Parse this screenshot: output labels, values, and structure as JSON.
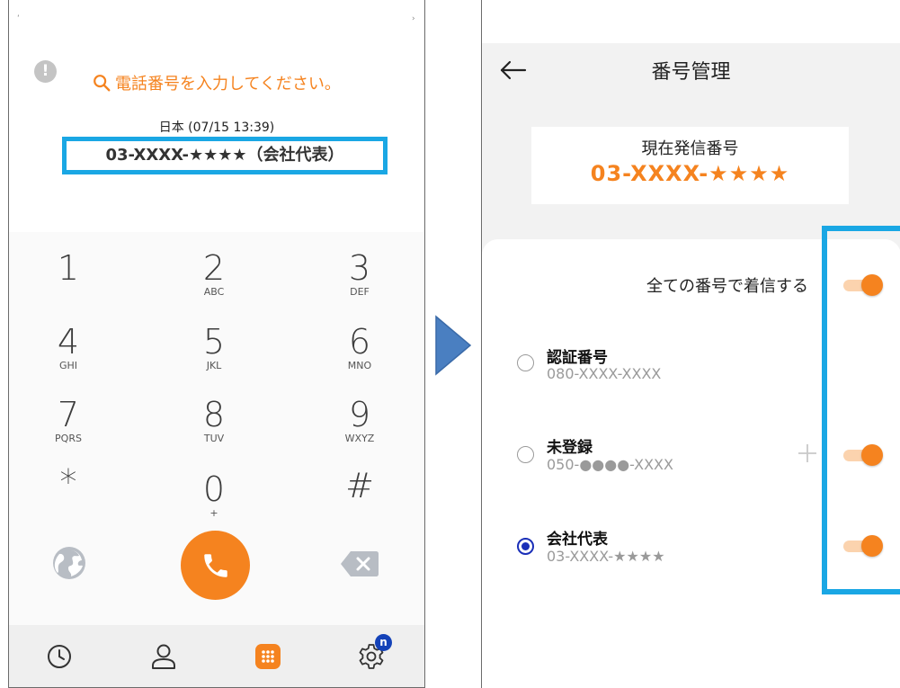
{
  "dialer": {
    "search_hint": "電話番号を入力してください。",
    "caller_country_time": "日本 (07/15 13:39)",
    "caller_number": "03-XXXX-★★★★（会社代表）",
    "keys": [
      {
        "digit": "1",
        "letters": ""
      },
      {
        "digit": "2",
        "letters": "ABC"
      },
      {
        "digit": "3",
        "letters": "DEF"
      },
      {
        "digit": "4",
        "letters": "GHI"
      },
      {
        "digit": "5",
        "letters": "JKL"
      },
      {
        "digit": "6",
        "letters": "MNO"
      },
      {
        "digit": "7",
        "letters": "PQRS"
      },
      {
        "digit": "8",
        "letters": "TUV"
      },
      {
        "digit": "9",
        "letters": "WXYZ"
      },
      {
        "digit": "*",
        "letters": ""
      },
      {
        "digit": "0",
        "letters": "+"
      },
      {
        "digit": "#",
        "letters": ""
      }
    ],
    "nav_badge": "n",
    "icons": {
      "alert": "alert-icon",
      "search": "search-icon",
      "globe": "globe-icon",
      "call": "phone-icon",
      "backspace": "backspace-icon",
      "history": "clock-icon",
      "contacts": "person-icon",
      "keypad": "keypad-icon",
      "settings": "gear-icon"
    }
  },
  "number_manager": {
    "title": "番号管理",
    "current_label": "現在発信番号",
    "current_number": "03-XXXX-★★★★",
    "all_numbers_label": "全ての番号で着信する",
    "all_numbers_on": true,
    "numbers": [
      {
        "name": "認証番号",
        "number": "080-XXXX-XXXX",
        "selected": false,
        "has_toggle": false,
        "has_add": false
      },
      {
        "name": "未登録",
        "number": "050-●●●●-XXXX",
        "selected": false,
        "has_toggle": true,
        "toggle_on": true,
        "has_add": true
      },
      {
        "name": "会社代表",
        "number": "03-XXXX-★★★★",
        "selected": true,
        "has_toggle": true,
        "toggle_on": true,
        "has_add": false
      }
    ]
  },
  "colors": {
    "accent": "#f5831f",
    "highlight": "#1aa7e4",
    "radio_selected": "#1a2fb8",
    "badge": "#1442b8"
  }
}
